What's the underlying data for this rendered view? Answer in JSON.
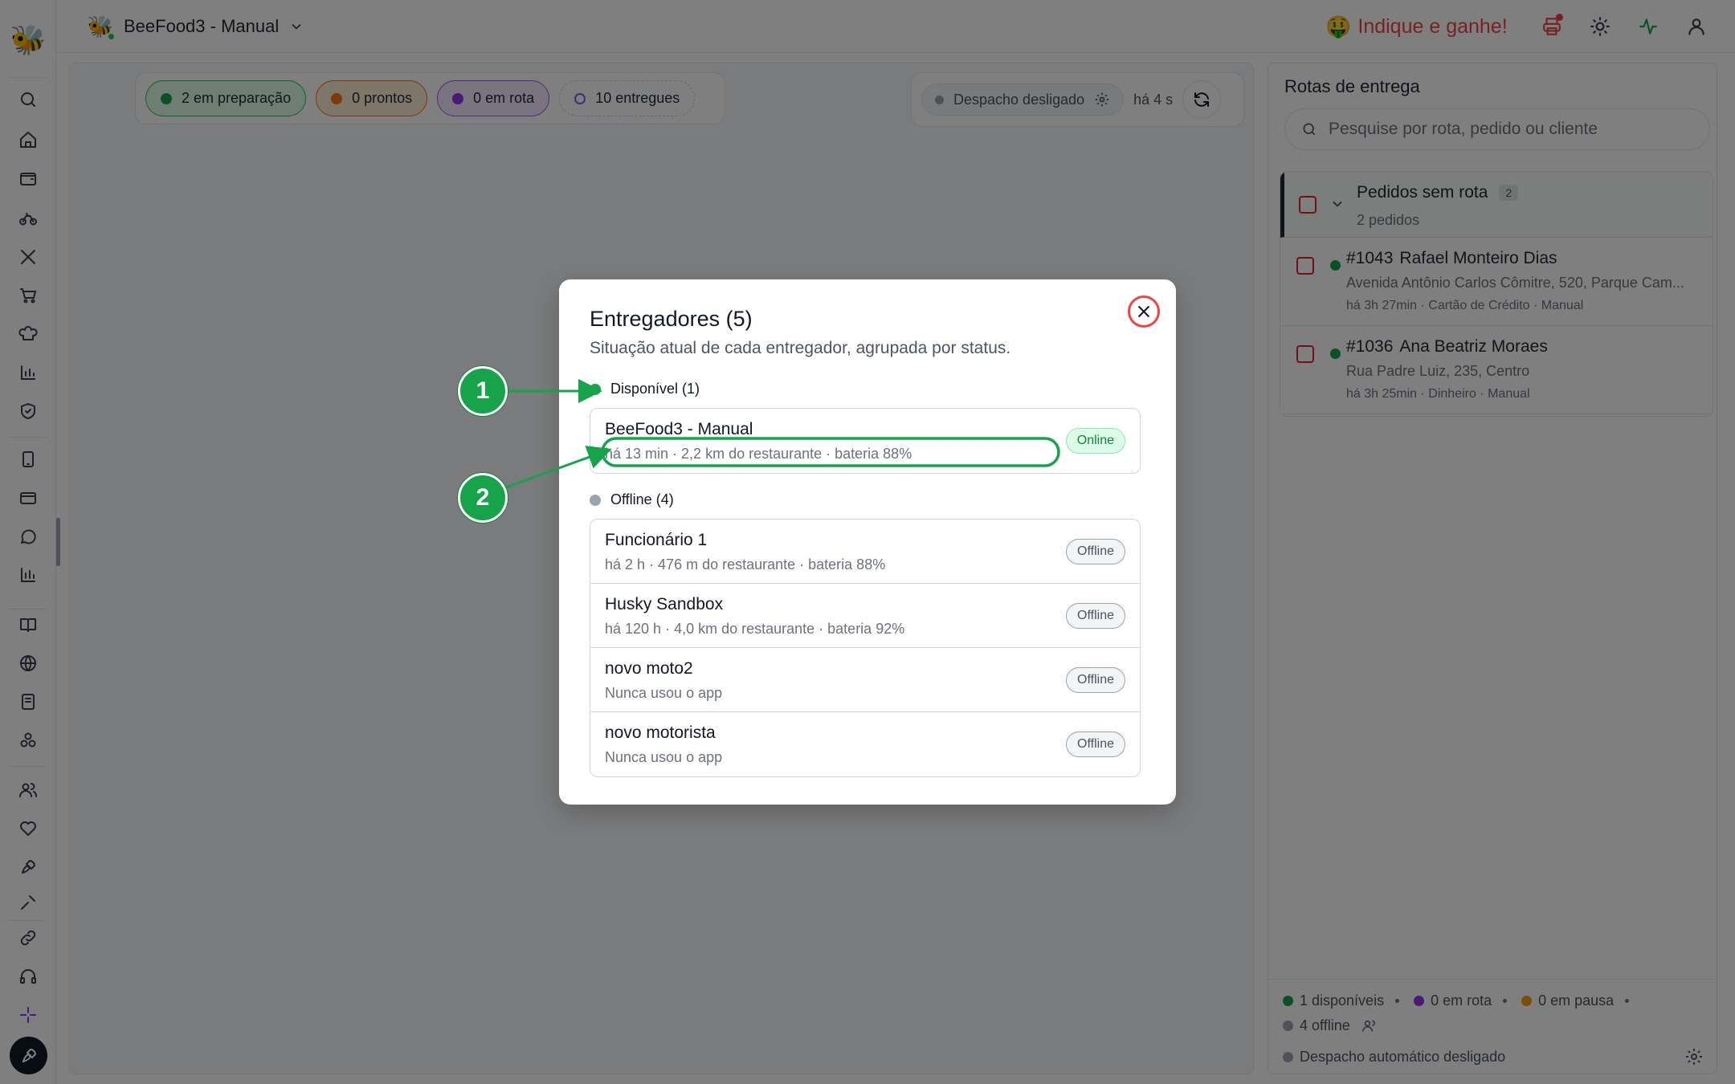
{
  "header": {
    "store_name": "BeeFood3 - Manual",
    "promo_label": "Indique e ganhe!"
  },
  "status_chips": [
    {
      "label": "2 em preparação"
    },
    {
      "label": "0 prontos"
    },
    {
      "label": "0 em rota"
    },
    {
      "label": "10 entregues"
    }
  ],
  "dispatch": {
    "status_label": "Despacho desligado",
    "updated": "há 4 s"
  },
  "routes_panel": {
    "title": "Rotas de entrega",
    "search_placeholder": "Pesquise por rota, pedido ou cliente",
    "group": {
      "title": "Pedidos sem rota",
      "count": "2",
      "subtitle": "2 pedidos"
    },
    "orders": [
      {
        "number": "#1043",
        "customer": "Rafael Monteiro Dias",
        "address": "Avenida Antônio Carlos Cômitre, 520, Parque Cam...",
        "meta": "há 3h 27min · Cartão de Crédito · Manual"
      },
      {
        "number": "#1036",
        "customer": "Ana Beatriz Moraes",
        "address": "Rua Padre Luiz, 235, Centro",
        "meta": "há 3h 25min · Dinheiro · Manual"
      }
    ],
    "footer": {
      "available": "1 disponíveis",
      "on_route": "0 em rota",
      "paused": "0 em pausa",
      "offline": "4 offline",
      "auto_dispatch": "Despacho automático desligado"
    }
  },
  "modal": {
    "title": "Entregadores (5)",
    "subtitle": "Situação atual de cada entregador, agrupada por status.",
    "available_section": "Disponível (1)",
    "offline_section": "Offline (4)",
    "available": [
      {
        "name": "BeeFood3 - Manual",
        "meta": "há 13 min · 2,2 km do restaurante · bateria 88%",
        "status": "Online"
      }
    ],
    "offline": [
      {
        "name": "Funcionário 1",
        "meta": "há 2 h · 476 m do restaurante · bateria 88%",
        "status": "Offline"
      },
      {
        "name": "Husky Sandbox",
        "meta": "há 120 h · 4,0 km do restaurante · bateria 92%",
        "status": "Offline"
      },
      {
        "name": "novo moto2",
        "meta": "Nunca usou o app",
        "status": "Offline"
      },
      {
        "name": "novo motorista",
        "meta": "Nunca usou o app",
        "status": "Offline"
      }
    ]
  },
  "annotations": [
    {
      "label": "1"
    },
    {
      "label": "2"
    }
  ],
  "colors": {
    "accent_green": "#16a34a",
    "alert_red": "#ef4444",
    "offline_gray": "#9ca3af"
  }
}
